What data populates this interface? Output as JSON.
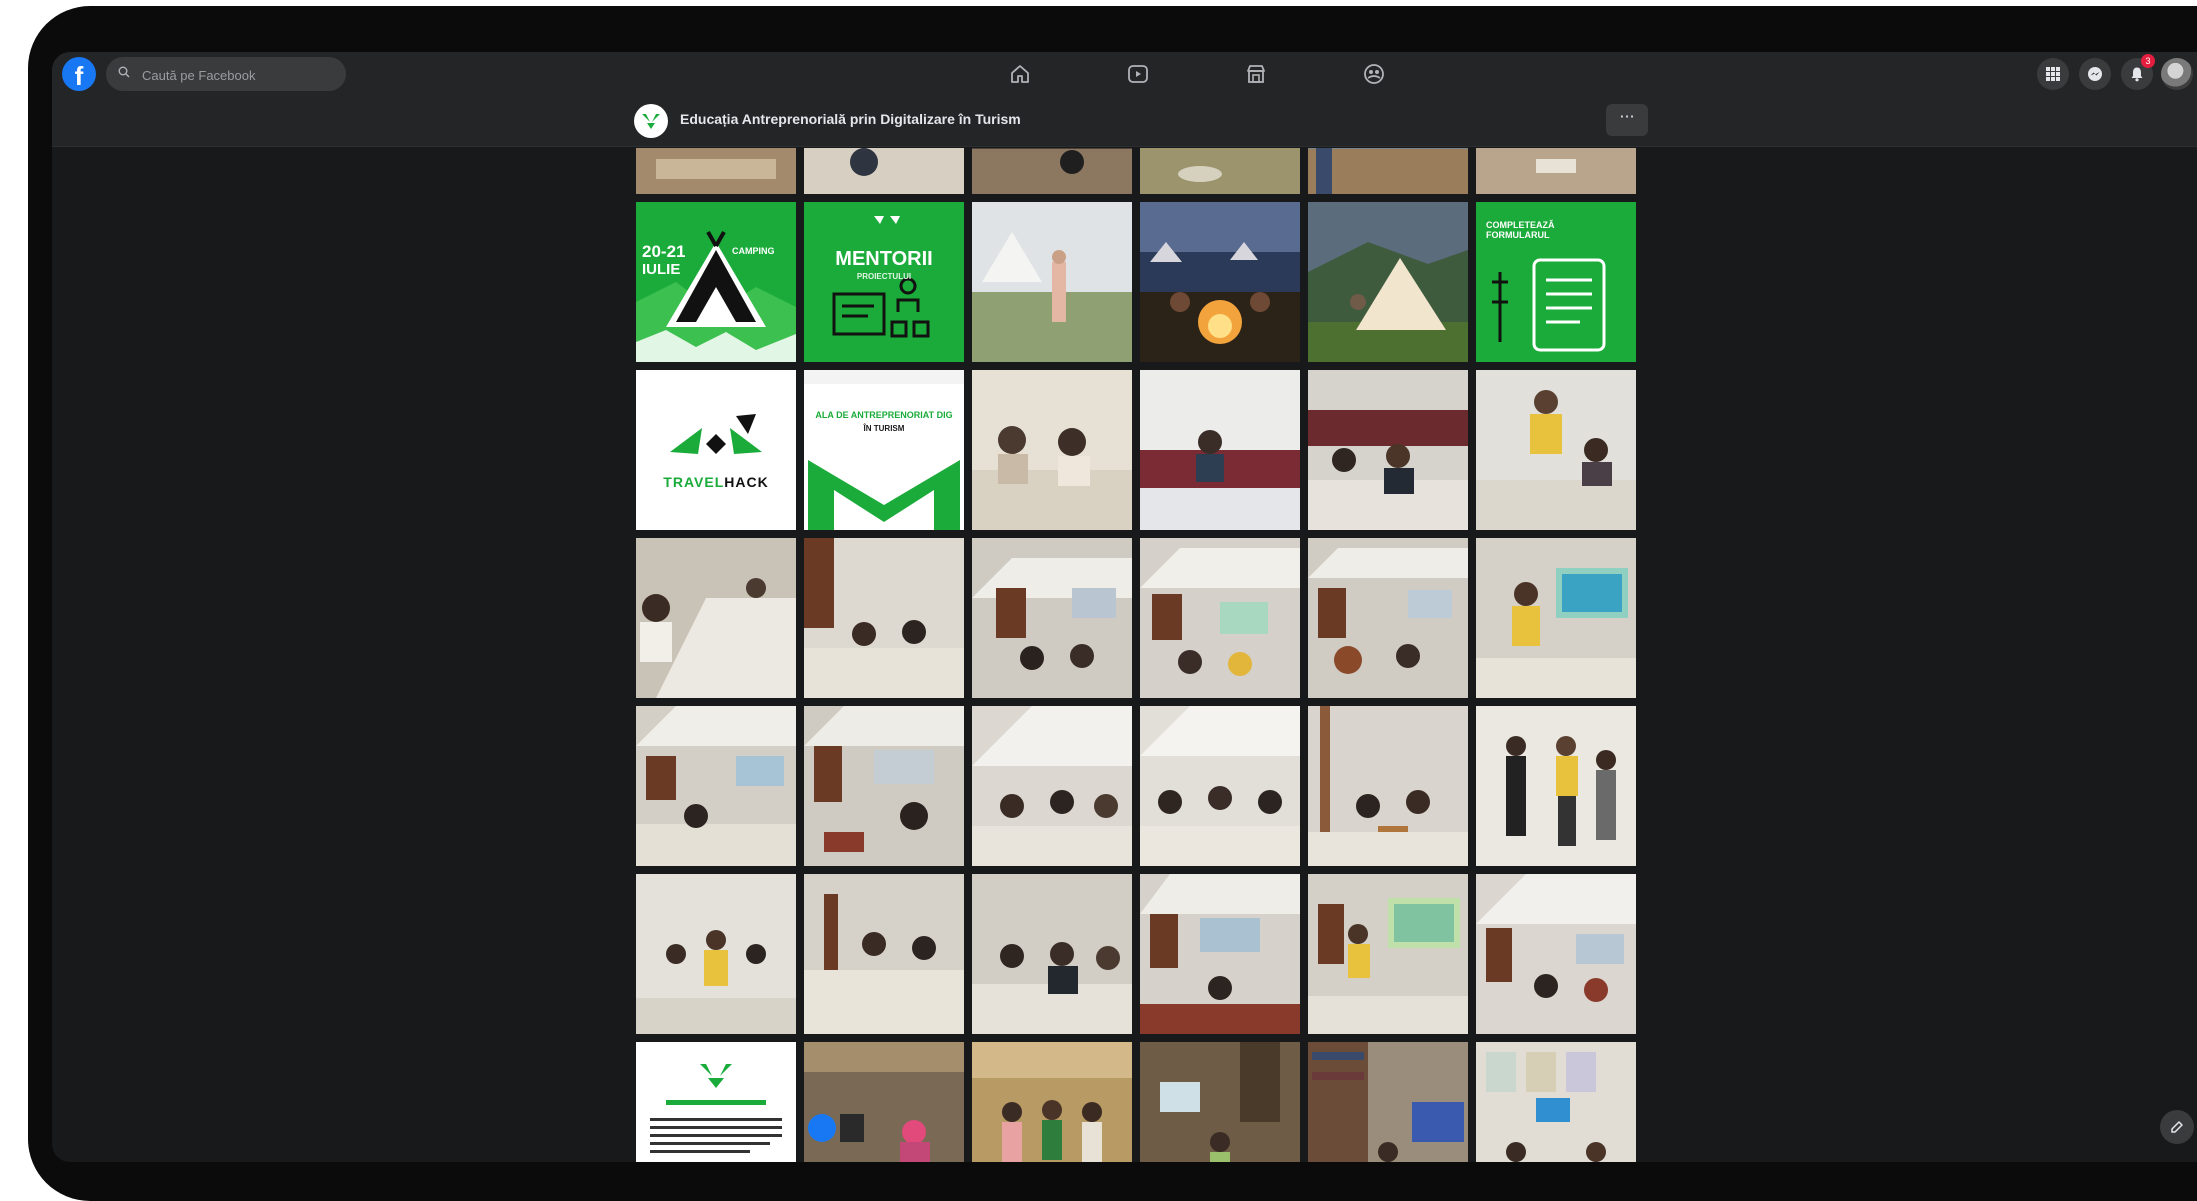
{
  "topnav": {
    "logo_letter": "f",
    "search_placeholder": "Caută pe Facebook",
    "notifications_count": "3"
  },
  "page": {
    "title": "Educația Antreprenorială prin Digitalizare în Turism",
    "more_label": "···"
  },
  "tiles": {
    "camping_date": "20-21",
    "camping_month": "IULIE",
    "camping_label": "CAMPING",
    "mentorii_title": "MENTORII",
    "mentorii_sub": "PROIECTULUI",
    "formular_title": "COMPLETEAZĂ FORMULARUL",
    "travelhack_a": "TRAVEL",
    "travelhack_b": "HACK",
    "scoala_title": "ALA DE ANTREPRENORIAT DIG",
    "scoala_sub": "ÎN TURISM"
  },
  "icons": {
    "home": "home-icon",
    "watch": "watch-icon",
    "marketplace": "marketplace-icon",
    "groups": "groups-icon",
    "menu": "menu-grid-icon",
    "messenger": "messenger-icon",
    "notifications": "bell-icon",
    "edit": "compose-icon"
  },
  "colors": {
    "fb_blue": "#1877f2",
    "brand_green": "#1aab3a",
    "nav_bg": "#242526",
    "page_bg": "#18191a"
  }
}
